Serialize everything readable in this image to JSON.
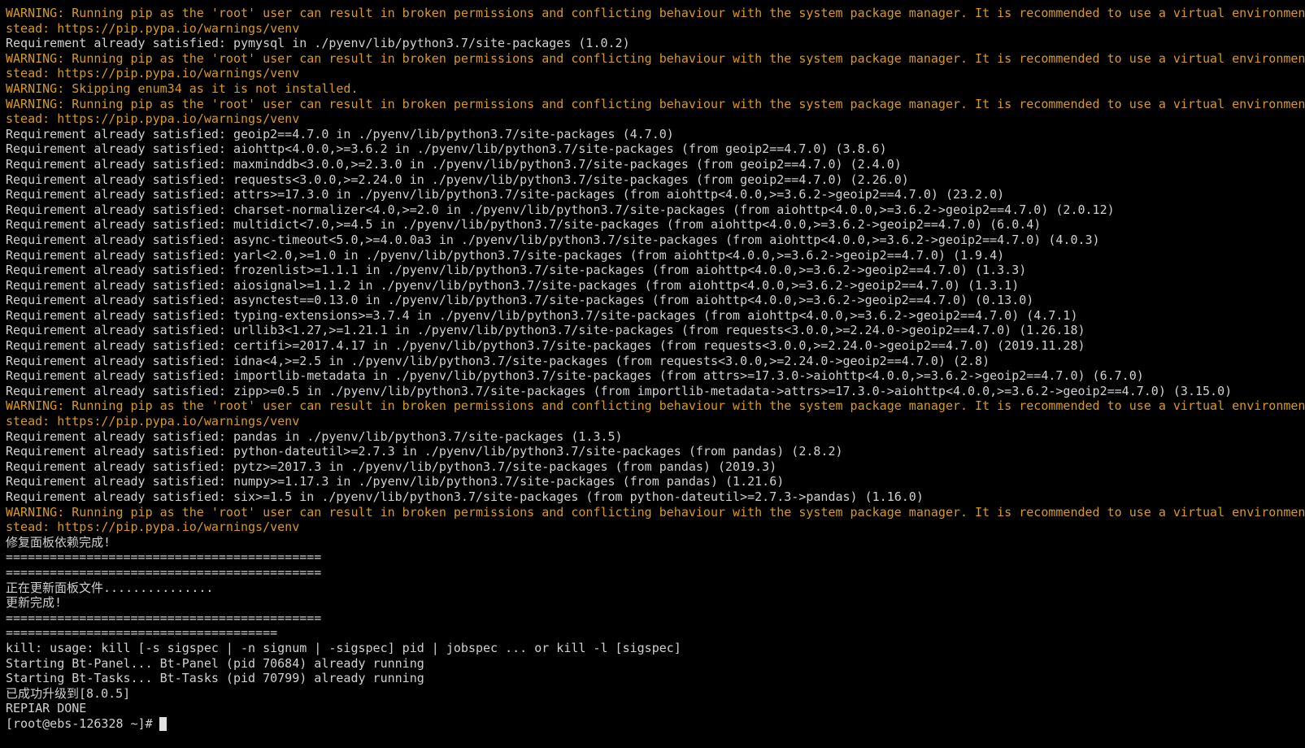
{
  "colors": {
    "background": "#000000",
    "normal_text": "#d0d0d0",
    "warning_text": "#d79a1e",
    "cursor": "#e0e0e0"
  },
  "lines": [
    {
      "type": "warning",
      "text": "WARNING: Running pip as the 'root' user can result in broken permissions and conflicting behaviour with the system package manager. It is recommended to use a virtual environment in"
    },
    {
      "type": "warning",
      "text": "stead: https://pip.pypa.io/warnings/venv"
    },
    {
      "type": "normal",
      "text": "Requirement already satisfied: pymysql in ./pyenv/lib/python3.7/site-packages (1.0.2)"
    },
    {
      "type": "warning",
      "text": "WARNING: Running pip as the 'root' user can result in broken permissions and conflicting behaviour with the system package manager. It is recommended to use a virtual environment in"
    },
    {
      "type": "warning",
      "text": "stead: https://pip.pypa.io/warnings/venv"
    },
    {
      "type": "warning",
      "text": "WARNING: Skipping enum34 as it is not installed."
    },
    {
      "type": "warning",
      "text": "WARNING: Running pip as the 'root' user can result in broken permissions and conflicting behaviour with the system package manager. It is recommended to use a virtual environment in"
    },
    {
      "type": "warning",
      "text": "stead: https://pip.pypa.io/warnings/venv"
    },
    {
      "type": "normal",
      "text": "Requirement already satisfied: geoip2==4.7.0 in ./pyenv/lib/python3.7/site-packages (4.7.0)"
    },
    {
      "type": "normal",
      "text": "Requirement already satisfied: aiohttp<4.0.0,>=3.6.2 in ./pyenv/lib/python3.7/site-packages (from geoip2==4.7.0) (3.8.6)"
    },
    {
      "type": "normal",
      "text": "Requirement already satisfied: maxminddb<3.0.0,>=2.3.0 in ./pyenv/lib/python3.7/site-packages (from geoip2==4.7.0) (2.4.0)"
    },
    {
      "type": "normal",
      "text": "Requirement already satisfied: requests<3.0.0,>=2.24.0 in ./pyenv/lib/python3.7/site-packages (from geoip2==4.7.0) (2.26.0)"
    },
    {
      "type": "normal",
      "text": "Requirement already satisfied: attrs>=17.3.0 in ./pyenv/lib/python3.7/site-packages (from aiohttp<4.0.0,>=3.6.2->geoip2==4.7.0) (23.2.0)"
    },
    {
      "type": "normal",
      "text": "Requirement already satisfied: charset-normalizer<4.0,>=2.0 in ./pyenv/lib/python3.7/site-packages (from aiohttp<4.0.0,>=3.6.2->geoip2==4.7.0) (2.0.12)"
    },
    {
      "type": "normal",
      "text": "Requirement already satisfied: multidict<7.0,>=4.5 in ./pyenv/lib/python3.7/site-packages (from aiohttp<4.0.0,>=3.6.2->geoip2==4.7.0) (6.0.4)"
    },
    {
      "type": "normal",
      "text": "Requirement already satisfied: async-timeout<5.0,>=4.0.0a3 in ./pyenv/lib/python3.7/site-packages (from aiohttp<4.0.0,>=3.6.2->geoip2==4.7.0) (4.0.3)"
    },
    {
      "type": "normal",
      "text": "Requirement already satisfied: yarl<2.0,>=1.0 in ./pyenv/lib/python3.7/site-packages (from aiohttp<4.0.0,>=3.6.2->geoip2==4.7.0) (1.9.4)"
    },
    {
      "type": "normal",
      "text": "Requirement already satisfied: frozenlist>=1.1.1 in ./pyenv/lib/python3.7/site-packages (from aiohttp<4.0.0,>=3.6.2->geoip2==4.7.0) (1.3.3)"
    },
    {
      "type": "normal",
      "text": "Requirement already satisfied: aiosignal>=1.1.2 in ./pyenv/lib/python3.7/site-packages (from aiohttp<4.0.0,>=3.6.2->geoip2==4.7.0) (1.3.1)"
    },
    {
      "type": "normal",
      "text": "Requirement already satisfied: asynctest==0.13.0 in ./pyenv/lib/python3.7/site-packages (from aiohttp<4.0.0,>=3.6.2->geoip2==4.7.0) (0.13.0)"
    },
    {
      "type": "normal",
      "text": "Requirement already satisfied: typing-extensions>=3.7.4 in ./pyenv/lib/python3.7/site-packages (from aiohttp<4.0.0,>=3.6.2->geoip2==4.7.0) (4.7.1)"
    },
    {
      "type": "normal",
      "text": "Requirement already satisfied: urllib3<1.27,>=1.21.1 in ./pyenv/lib/python3.7/site-packages (from requests<3.0.0,>=2.24.0->geoip2==4.7.0) (1.26.18)"
    },
    {
      "type": "normal",
      "text": "Requirement already satisfied: certifi>=2017.4.17 in ./pyenv/lib/python3.7/site-packages (from requests<3.0.0,>=2.24.0->geoip2==4.7.0) (2019.11.28)"
    },
    {
      "type": "normal",
      "text": "Requirement already satisfied: idna<4,>=2.5 in ./pyenv/lib/python3.7/site-packages (from requests<3.0.0,>=2.24.0->geoip2==4.7.0) (2.8)"
    },
    {
      "type": "normal",
      "text": "Requirement already satisfied: importlib-metadata in ./pyenv/lib/python3.7/site-packages (from attrs>=17.3.0->aiohttp<4.0.0,>=3.6.2->geoip2==4.7.0) (6.7.0)"
    },
    {
      "type": "normal",
      "text": "Requirement already satisfied: zipp>=0.5 in ./pyenv/lib/python3.7/site-packages (from importlib-metadata->attrs>=17.3.0->aiohttp<4.0.0,>=3.6.2->geoip2==4.7.0) (3.15.0)"
    },
    {
      "type": "warning",
      "text": "WARNING: Running pip as the 'root' user can result in broken permissions and conflicting behaviour with the system package manager. It is recommended to use a virtual environment in"
    },
    {
      "type": "warning",
      "text": "stead: https://pip.pypa.io/warnings/venv"
    },
    {
      "type": "normal",
      "text": "Requirement already satisfied: pandas in ./pyenv/lib/python3.7/site-packages (1.3.5)"
    },
    {
      "type": "normal",
      "text": "Requirement already satisfied: python-dateutil>=2.7.3 in ./pyenv/lib/python3.7/site-packages (from pandas) (2.8.2)"
    },
    {
      "type": "normal",
      "text": "Requirement already satisfied: pytz>=2017.3 in ./pyenv/lib/python3.7/site-packages (from pandas) (2019.3)"
    },
    {
      "type": "normal",
      "text": "Requirement already satisfied: numpy>=1.17.3 in ./pyenv/lib/python3.7/site-packages (from pandas) (1.21.6)"
    },
    {
      "type": "normal",
      "text": "Requirement already satisfied: six>=1.5 in ./pyenv/lib/python3.7/site-packages (from python-dateutil>=2.7.3->pandas) (1.16.0)"
    },
    {
      "type": "warning",
      "text": "WARNING: Running pip as the 'root' user can result in broken permissions and conflicting behaviour with the system package manager. It is recommended to use a virtual environment in"
    },
    {
      "type": "warning",
      "text": "stead: https://pip.pypa.io/warnings/venv"
    },
    {
      "type": "normal",
      "text": "修复面板依赖完成!"
    },
    {
      "type": "normal",
      "text": "==========================================="
    },
    {
      "type": "normal",
      "text": "==========================================="
    },
    {
      "type": "normal",
      "text": "正在更新面板文件..............."
    },
    {
      "type": "normal",
      "text": "更新完成!"
    },
    {
      "type": "normal",
      "text": "==========================================="
    },
    {
      "type": "normal",
      "text": "====================================="
    },
    {
      "type": "normal",
      "text": "kill: usage: kill [-s sigspec | -n signum | -sigspec] pid | jobspec ... or kill -l [sigspec]"
    },
    {
      "type": "normal",
      "text": "Starting Bt-Panel... Bt-Panel (pid 70684) already running"
    },
    {
      "type": "normal",
      "text": "Starting Bt-Tasks... Bt-Tasks (pid 70799) already running"
    },
    {
      "type": "normal",
      "text": "已成功升级到[8.0.5]"
    },
    {
      "type": "normal",
      "text": "REPIAR DONE"
    }
  ],
  "prompt": {
    "text": "[root@ebs-126328 ~]#"
  }
}
